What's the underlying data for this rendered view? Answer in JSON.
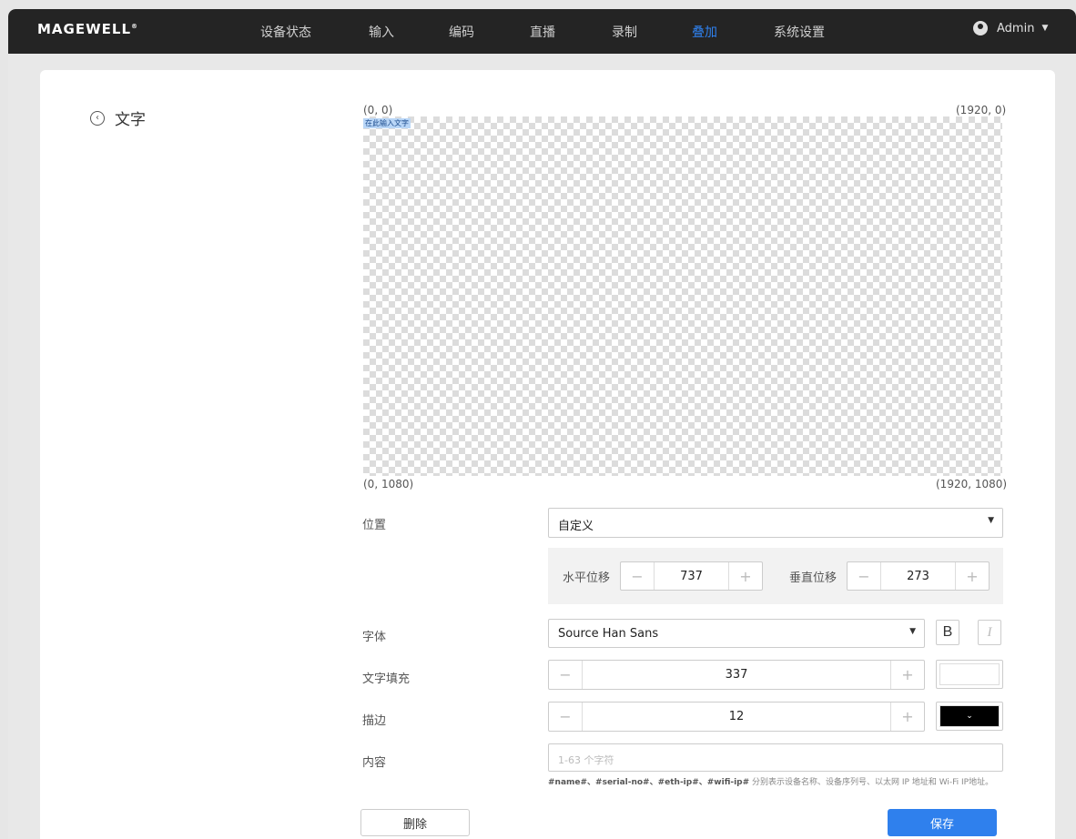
{
  "brand": {
    "logo": "MAGEWELL",
    "reg": "®"
  },
  "nav": {
    "items": [
      {
        "label": "设备状态"
      },
      {
        "label": "输入"
      },
      {
        "label": "编码"
      },
      {
        "label": "直播"
      },
      {
        "label": "录制"
      },
      {
        "label": "叠加",
        "active": true
      },
      {
        "label": "系统设置"
      }
    ],
    "user": "Admin"
  },
  "page": {
    "back_title": "文字"
  },
  "preview": {
    "coord_tl": "(0, 0)",
    "coord_tr": "(1920, 0)",
    "coord_bl": "(0, 1080)",
    "coord_br": "(1920, 1080)",
    "overlay_text": "在此输入文字"
  },
  "form": {
    "position_label": "位置",
    "position_value": "自定义",
    "h_offset_label": "水平位移",
    "h_offset_value": "737",
    "v_offset_label": "垂直位移",
    "v_offset_value": "273",
    "font_label": "字体",
    "font_value": "Source Han Sans",
    "bold_label": "B",
    "italic_label": "I",
    "fill_label": "文字填充",
    "fill_value": "337",
    "fill_color": "#ffffff",
    "stroke_label": "描边",
    "stroke_value": "12",
    "stroke_color": "#000000",
    "content_label": "内容",
    "content_placeholder": "1-63 个字符",
    "hint_tokens": "#name#、#serial-no#、#eth-ip#、#wifi-ip#",
    "hint_text": " 分别表示设备名称、设备序列号、以太网 IP 地址和 Wi-Fi IP地址。"
  },
  "actions": {
    "delete_label": "删除",
    "save_label": "保存"
  },
  "colors": {
    "accent": "#2f80ed",
    "navbar": "#242424"
  }
}
